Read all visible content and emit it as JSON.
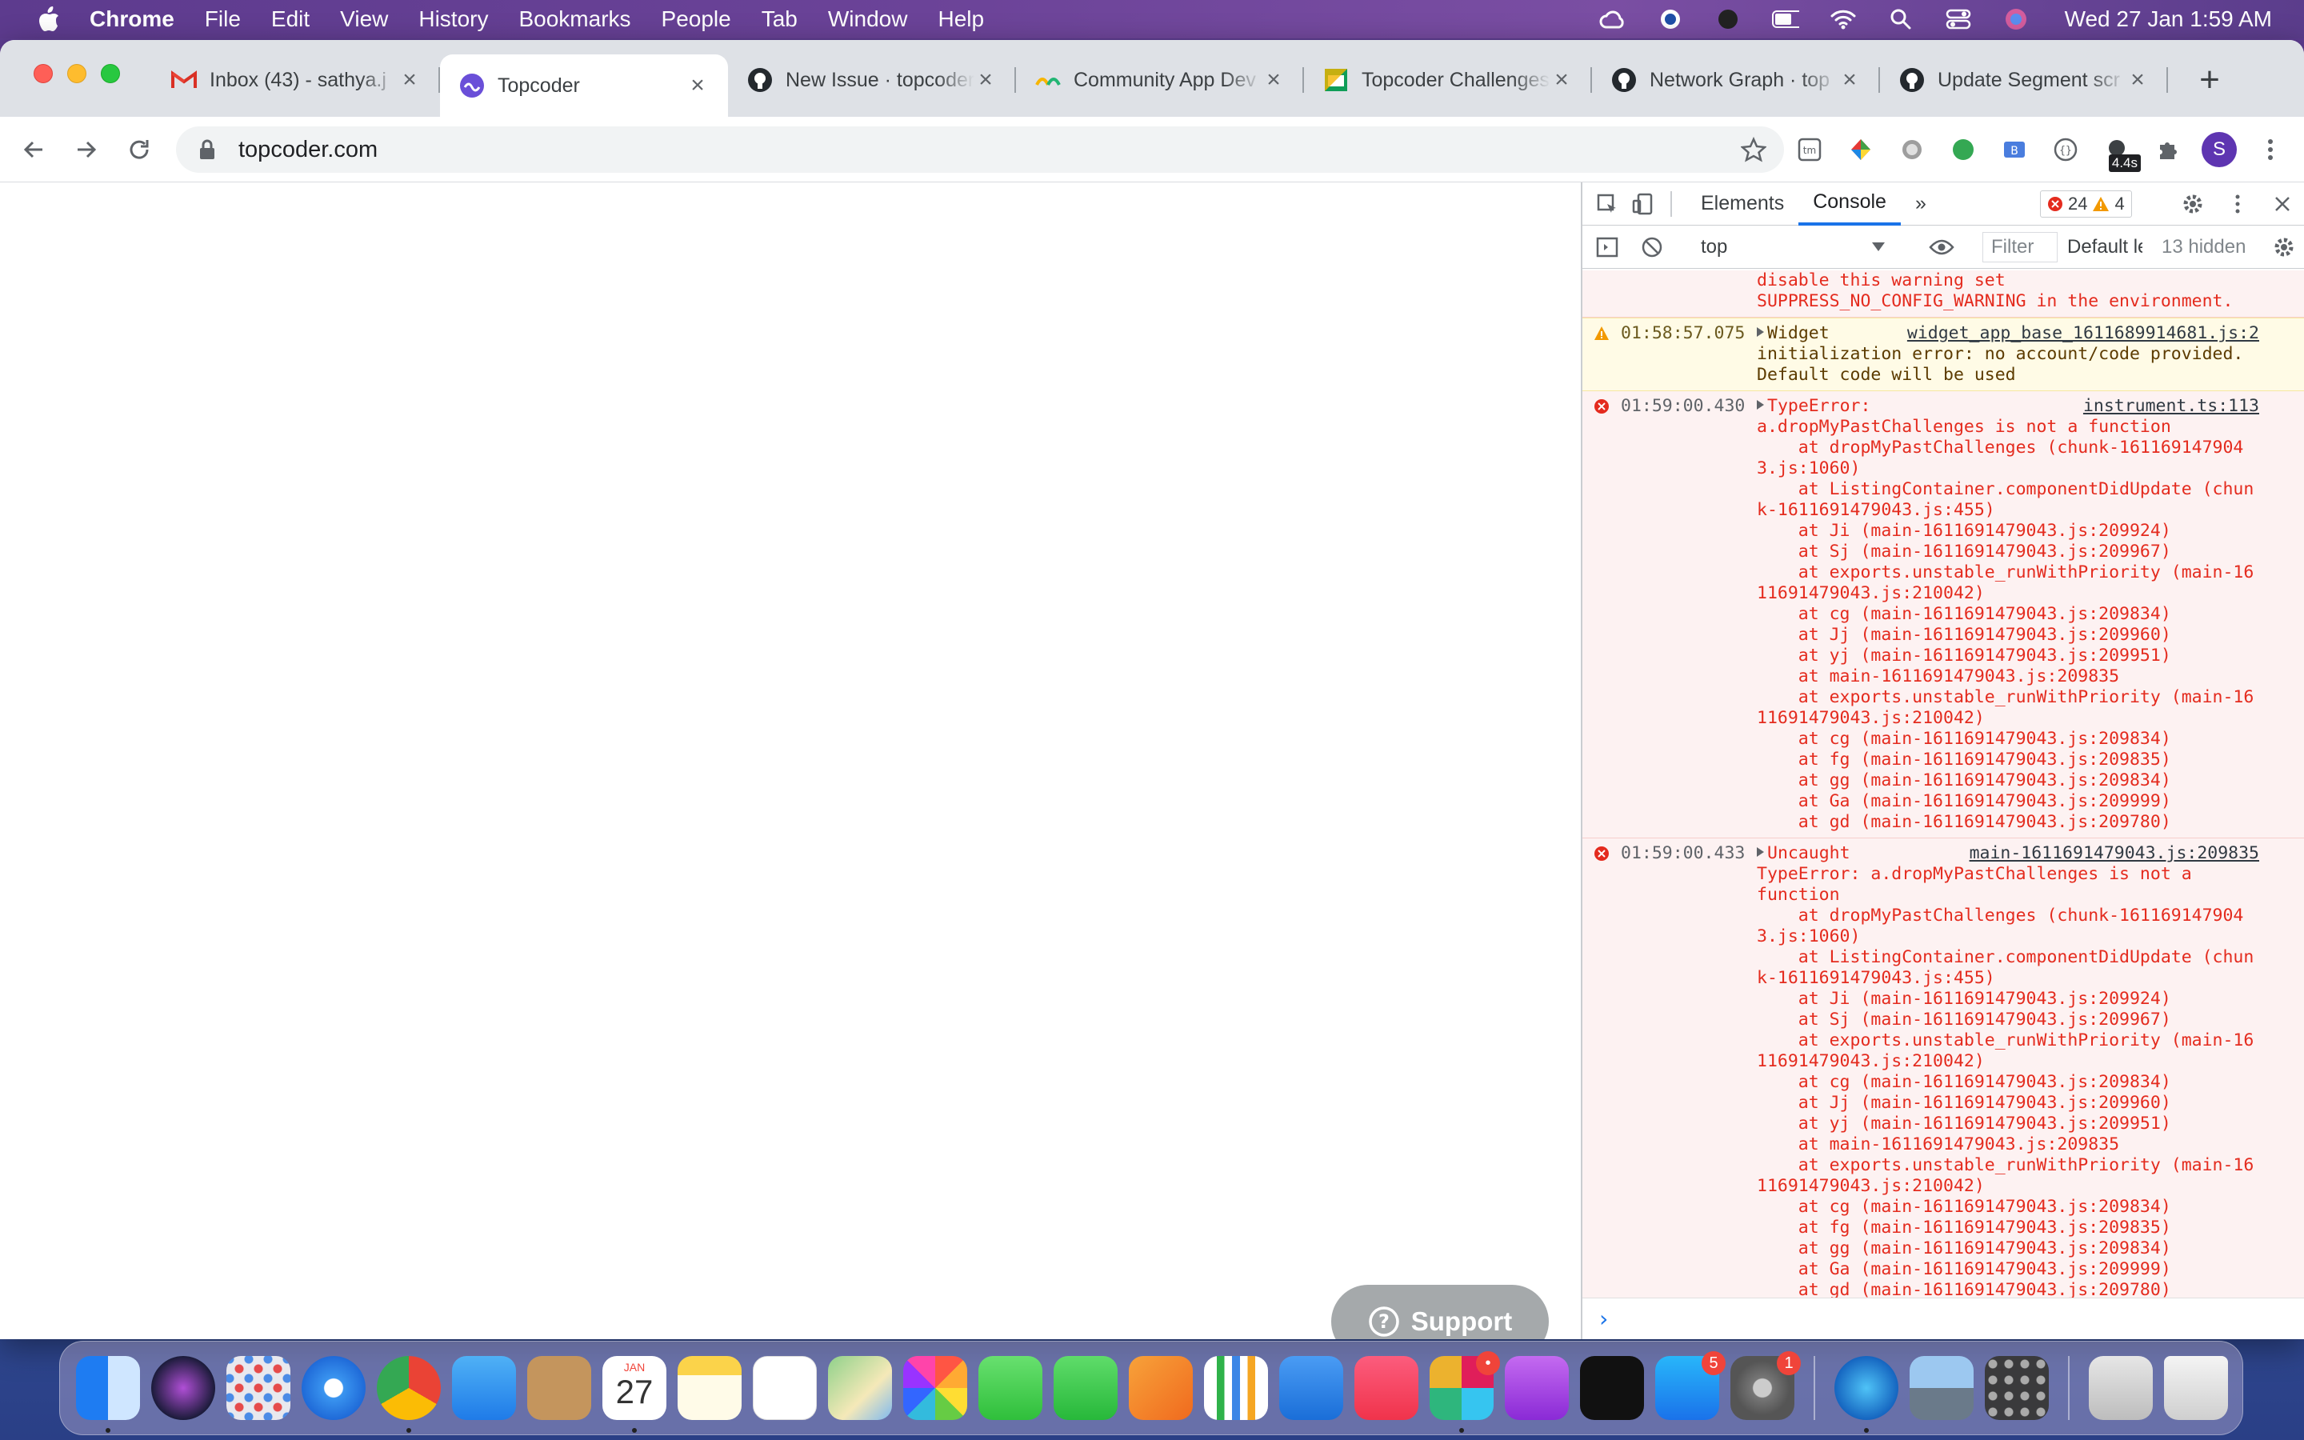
{
  "menubar": {
    "app_name": "Chrome",
    "items": [
      "File",
      "Edit",
      "View",
      "History",
      "Bookmarks",
      "People",
      "Tab",
      "Window",
      "Help"
    ],
    "clock": "Wed 27 Jan  1:59 AM"
  },
  "browser": {
    "tabs": [
      {
        "title": "Inbox (43) - sathya.j",
        "icon": "gmail-icon"
      },
      {
        "title": "Topcoder",
        "icon": "topcoder-icon",
        "active": true
      },
      {
        "title": "New Issue · topcoder",
        "icon": "github-icon"
      },
      {
        "title": "Community App Dev",
        "icon": "community-icon"
      },
      {
        "title": "Topcoder Challenges",
        "icon": "sheets-icon"
      },
      {
        "title": "Network Graph · top",
        "icon": "github-icon"
      },
      {
        "title": "Update Segment scr",
        "icon": "github-icon"
      }
    ],
    "url": "topcoder.com",
    "extension_badge": "4.4s",
    "profile_initial": "S"
  },
  "page": {
    "support_label": "Support"
  },
  "devtools": {
    "tabs": [
      "Elements",
      "Console"
    ],
    "more": "»",
    "error_count": "24",
    "warning_count": "4",
    "context": "top",
    "filter_placeholder": "Filter",
    "levels": "Default levels",
    "hidden": "13 hidden",
    "messages": [
      {
        "type": "err",
        "timestamp": "",
        "source": "",
        "text": "disable this warning set\nSUPPRESS_NO_CONFIG_WARNING in the environment."
      },
      {
        "type": "warn",
        "timestamp": "01:58:57.075",
        "source": "widget_app_base_1611689914681.js:2",
        "head": "Widget",
        "text": "initialization error: no account/code provided.\nDefault code will be used"
      },
      {
        "type": "err",
        "timestamp": "01:59:00.430",
        "source": "instrument.ts:113",
        "head": "TypeError:",
        "text": "a.dropMyPastChallenges is not a function\n    at dropMyPastChallenges (chunk-161169147904\n3.js:1060)\n    at ListingContainer.componentDidUpdate (chun\nk-1611691479043.js:455)\n    at Ji (main-1611691479043.js:209924)\n    at Sj (main-1611691479043.js:209967)\n    at exports.unstable_runWithPriority (main-16\n11691479043.js:210042)\n    at cg (main-1611691479043.js:209834)\n    at Jj (main-1611691479043.js:209960)\n    at yj (main-1611691479043.js:209951)\n    at main-1611691479043.js:209835\n    at exports.unstable_runWithPriority (main-16\n11691479043.js:210042)\n    at cg (main-1611691479043.js:209834)\n    at fg (main-1611691479043.js:209835)\n    at gg (main-1611691479043.js:209834)\n    at Ga (main-1611691479043.js:209999)\n    at gd (main-1611691479043.js:209780)"
      },
      {
        "type": "err",
        "timestamp": "01:59:00.433",
        "source": "main-1611691479043.js:209835",
        "head": "Uncaught",
        "text": "TypeError: a.dropMyPastChallenges is not a\nfunction\n    at dropMyPastChallenges (chunk-161169147904\n3.js:1060)\n    at ListingContainer.componentDidUpdate (chun\nk-1611691479043.js:455)\n    at Ji (main-1611691479043.js:209924)\n    at Sj (main-1611691479043.js:209967)\n    at exports.unstable_runWithPriority (main-16\n11691479043.js:210042)\n    at cg (main-1611691479043.js:209834)\n    at Jj (main-1611691479043.js:209960)\n    at yj (main-1611691479043.js:209951)\n    at main-1611691479043.js:209835\n    at exports.unstable_runWithPriority (main-16\n11691479043.js:210042)\n    at cg (main-1611691479043.js:209834)\n    at fg (main-1611691479043.js:209835)\n    at gg (main-1611691479043.js:209834)\n    at Ga (main-1611691479043.js:209999)\n    at gd (main-1611691479043.js:209780)"
      }
    ],
    "prompt": "›"
  },
  "dock": {
    "calendar_month": "JAN",
    "calendar_day": "27",
    "slack_badge": "•",
    "appstore_badge": "5",
    "prefs_badge": "1",
    "apps": [
      "finder",
      "siri",
      "launchpad",
      "safari",
      "chrome",
      "mail",
      "contacts",
      "calendar",
      "notes",
      "reminders",
      "maps",
      "photos",
      "messages",
      "facetime",
      "pages",
      "numbers",
      "keynote",
      "music",
      "slack",
      "podcasts",
      "tv",
      "app-store",
      "system-preferences",
      "pixelmator",
      "preview",
      "calculator",
      "documents",
      "trash"
    ]
  },
  "colors": {
    "console_error": "#e42b1e",
    "active_tab_underline": "#1a73e8",
    "support_button": "#a5a9ab"
  }
}
